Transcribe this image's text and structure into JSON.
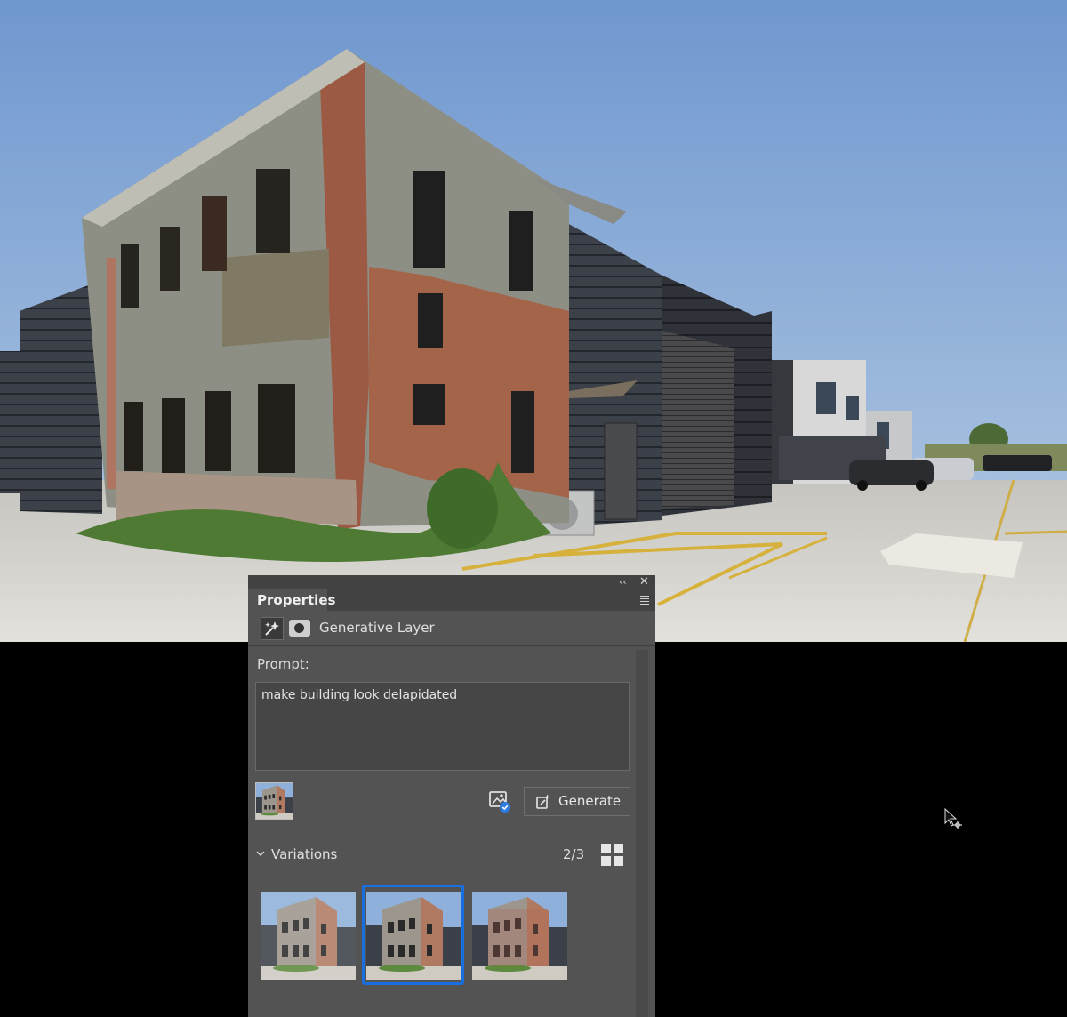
{
  "panel": {
    "tab_label": "Properties",
    "layer_name": "Generative Layer",
    "prompt_label": "Prompt:",
    "prompt_value": "make building look delapidated",
    "generate_label": "Generate",
    "variations_label": "Variations",
    "variations_counter": "2/3",
    "selected_variation": 2,
    "variation_count": 3
  },
  "colors": {
    "panel_bg": "#535353",
    "panel_header": "#424242",
    "selection_accent": "#1a6fe0",
    "content_credentials_badge": "#2d7be5"
  },
  "icons": {
    "collapse": "double-chevron-left-icon",
    "close": "close-icon",
    "panel_menu": "hamburger-menu-icon",
    "layer": "generative-layer-icon",
    "mask": "layer-mask-icon",
    "content_credentials": "content-credentials-icon",
    "generate": "generate-icon",
    "variations_toggle": "chevron-down-icon",
    "grid_view": "grid-view-icon",
    "cursor": "move-cursor-icon"
  }
}
